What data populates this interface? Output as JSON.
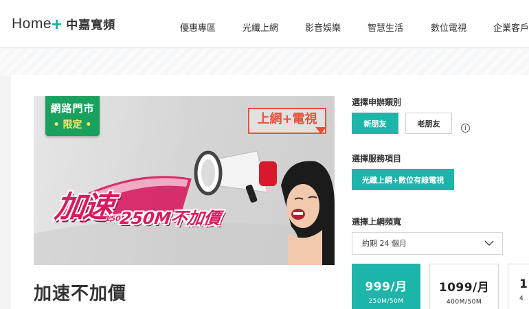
{
  "header": {
    "logo_word": "Home",
    "logo_plus": "+",
    "logo_cn": "中嘉寬頻",
    "nav": [
      "優惠專區",
      "光纖上網",
      "影音娛樂",
      "智慧生活",
      "數位電視",
      "企業客戶"
    ]
  },
  "banner": {
    "badge_top": "網路門市",
    "badge_bottom": "• 限定 •",
    "tag": "上網+電視",
    "headline_big": "加速",
    "headline_mini": "150M>",
    "headline_small": "250M不加價"
  },
  "product": {
    "title": "加速不加價"
  },
  "panel": {
    "apply_type_label": "選擇申辦類別",
    "apply_types": [
      "新朋友",
      "老朋友"
    ],
    "service_label": "選擇服務項目",
    "service_option": "光纖上網+數位有線電視",
    "bandwidth_label": "選擇上網頻寬",
    "contract_select": "約期 24 個月",
    "plans": [
      {
        "price": "999/月",
        "speed": "250M/50M",
        "selected": true
      },
      {
        "price": "1099/月",
        "speed": "400M/50M",
        "selected": false
      },
      {
        "price": "1",
        "speed": "4",
        "selected": false
      }
    ]
  },
  "colors": {
    "accent": "#1db5aa",
    "promo_red": "#e9503b",
    "headline_pink": "#d81b60",
    "badge_green": "#1aa15e"
  }
}
